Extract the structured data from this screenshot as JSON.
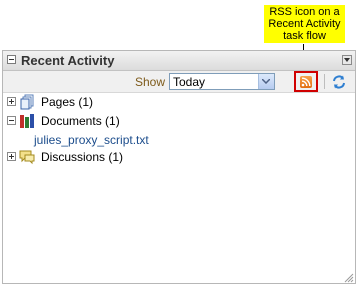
{
  "callout": {
    "text": "RSS icon on a Recent Activity task flow"
  },
  "panel": {
    "title": "Recent Activity",
    "toolbar": {
      "show_label": "Show",
      "show_value": "Today"
    }
  },
  "tree": {
    "items": [
      {
        "label": "Pages (1)",
        "icon": "pages-icon"
      },
      {
        "label": "Documents (1)",
        "icon": "documents-icon"
      },
      {
        "label": "julies_proxy_script.txt"
      },
      {
        "label": "Discussions (1)",
        "icon": "discussions-icon"
      }
    ]
  },
  "colors": {
    "callout_bg": "#ffff00",
    "highlight_border": "#d00000",
    "rss_orange": "#e26d10",
    "link_blue": "#1c4d8c"
  }
}
